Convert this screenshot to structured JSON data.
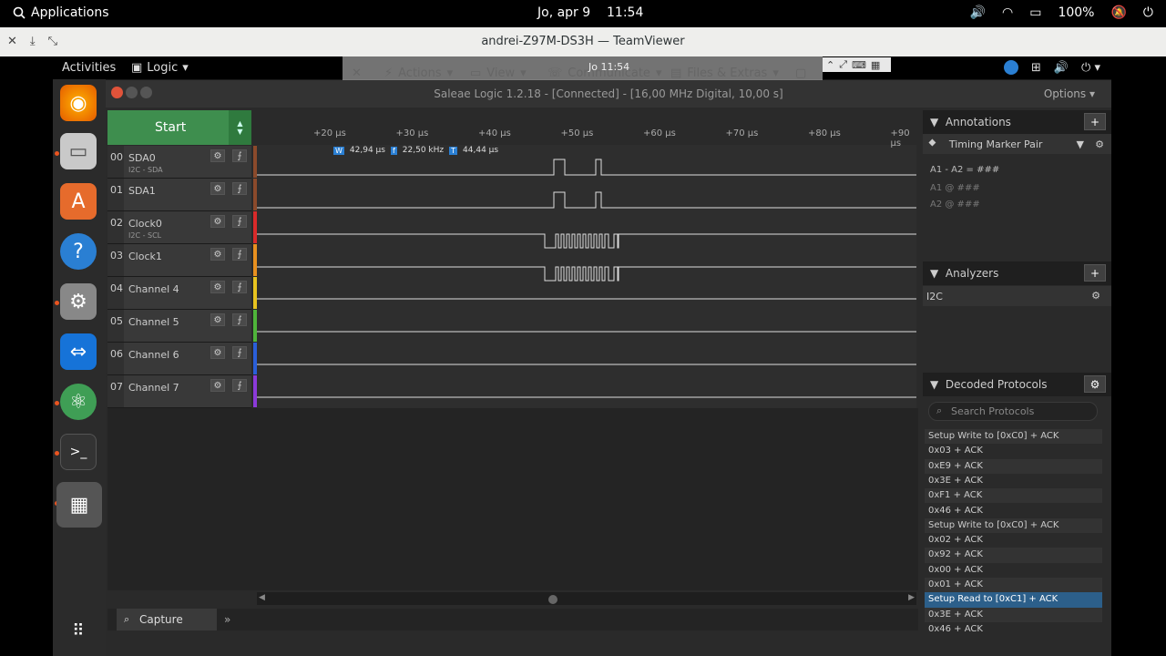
{
  "topbar": {
    "apps_label": "Applications",
    "date": "Jo, apr 9",
    "time": "11:54",
    "battery": "100%"
  },
  "teamviewer": {
    "title": "andrei-Z97M-DS3H — TeamViewer",
    "menu": {
      "actions": "Actions",
      "view": "View",
      "communicate": "Communicate",
      "files": "Files & Extras",
      "time": "Jo 11:54"
    }
  },
  "gnome": {
    "activities": "Activities",
    "app": "Logic"
  },
  "dock": {
    "apps": [
      "firefox",
      "files",
      "software",
      "help",
      "settings",
      "teamviewer",
      "atom",
      "terminal",
      "logic"
    ]
  },
  "saleae": {
    "title": "Saleae Logic 1.2.18 - [Connected] - [16,00 MHz Digital, 10,00 s]",
    "options": "Options ▾",
    "start": "Start",
    "channels": [
      {
        "num": "00",
        "name": "SDA0",
        "sub": "I2C - SDA",
        "color": "#8b4a2b"
      },
      {
        "num": "01",
        "name": "SDA1",
        "sub": "",
        "color": "#8b4a2b"
      },
      {
        "num": "02",
        "name": "Clock0",
        "sub": "I2C - SCL",
        "color": "#d92a2a"
      },
      {
        "num": "03",
        "name": "Clock1",
        "sub": "",
        "color": "#e8901f"
      },
      {
        "num": "04",
        "name": "Channel 4",
        "sub": "",
        "color": "#e8c41f"
      },
      {
        "num": "05",
        "name": "Channel 5",
        "sub": "",
        "color": "#4fb43a"
      },
      {
        "num": "06",
        "name": "Channel 6",
        "sub": "",
        "color": "#2a5fd9"
      },
      {
        "num": "07",
        "name": "Channel 7",
        "sub": "",
        "color": "#8b3ad9"
      }
    ],
    "ruler": [
      "+20 µs",
      "+30 µs",
      "+40 µs",
      "+50 µs",
      "+60 µs",
      "+70 µs",
      "+80 µs",
      "+90 µs"
    ],
    "measure": {
      "w_label": "W",
      "w": "42,94 µs",
      "f_label": "f",
      "f": "22,50 kHz",
      "t_label": "T",
      "t": "44,44 µs"
    },
    "capture": "Capture",
    "annotations": {
      "title": "Annotations",
      "marker": "Timing Marker Pair",
      "formula": "A1 - A2 = ###",
      "a1": "A1 @ ###",
      "a2": "A2 @ ###"
    },
    "analyzers": {
      "title": "Analyzers",
      "items": [
        "I2C"
      ]
    },
    "decoded": {
      "title": "Decoded Protocols",
      "search_placeholder": "Search Protocols",
      "rows": [
        "Setup Write to [0xC0] + ACK",
        "0x03 + ACK",
        "0xE9 + ACK",
        "0x3E + ACK",
        "0xF1 + ACK",
        "0x46 + ACK",
        "Setup Write to [0xC0] + ACK",
        "0x02 + ACK",
        "0x92 + ACK",
        "0x00 + ACK",
        "0x01 + ACK",
        "Setup Read to [0xC1] + ACK",
        "0x3E + ACK",
        "0x46 + ACK"
      ],
      "selected_index": 11
    }
  }
}
